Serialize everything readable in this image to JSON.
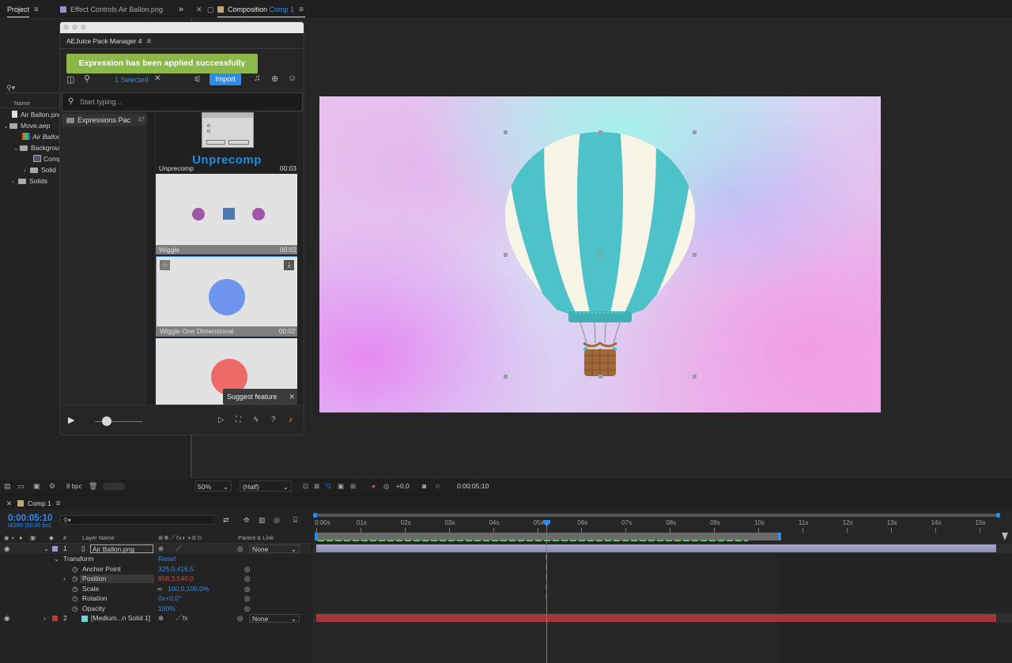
{
  "top_tabs": {
    "project": "Project",
    "effect_controls": "Effect Controls Air Ballon.png",
    "composition_prefix": "Composition",
    "composition_name": "Comp 1"
  },
  "project_panel": {
    "search_placeholder": "",
    "column_name": "Name",
    "items": [
      {
        "label": "Air Ballon.png"
      },
      {
        "label": "Move.aep"
      },
      {
        "label": "Air Ballon"
      },
      {
        "label": "Backgrou"
      },
      {
        "label": "Comp"
      },
      {
        "label": "Solid"
      },
      {
        "label": "Solids"
      }
    ],
    "footer_bpc": "8 bpc"
  },
  "pack_manager": {
    "title": "AEJuice Pack Manager 4",
    "toast": "Expression has been applied successfully",
    "selected_label": "1 Selected",
    "import_label": "Import",
    "search_placeholder": "Start typing...",
    "category_label": "Expressions Pac",
    "category_count": "47",
    "cards": [
      {
        "title": "Unprecomp",
        "label": "Unprecomp",
        "time": "00:03"
      },
      {
        "label": "Wiggle",
        "time": "00:02"
      },
      {
        "label": "Wiggle One Dimensional",
        "time": "00:02"
      },
      {
        "label": "",
        "time": ""
      }
    ],
    "suggest_feature": "Suggest feature"
  },
  "comp_footer": {
    "zoom": "50%",
    "resolution": "(Half)",
    "exposure": "+0,0",
    "timecode": "0:00:05:10"
  },
  "timeline": {
    "tab_label": "Comp 1",
    "current_time": "0:00:05:10",
    "frames_fps": "00260 (50.00 fps)",
    "col_layer_name": "Layer Name",
    "col_parent": "Parent & Link",
    "ticks": [
      "0:00s",
      "01s",
      "02s",
      "03s",
      "04s",
      "05s",
      "06s",
      "07s",
      "08s",
      "09s",
      "10s",
      "11s",
      "12s",
      "13s",
      "14s",
      "15s"
    ],
    "layers": [
      {
        "index": "1",
        "name": "Air Ballon.png",
        "parent": "None",
        "color": "#9a9ad6"
      },
      {
        "index": "2",
        "name": "[Medium...n Solid 1]",
        "parent": "None",
        "color": "#c0383a"
      }
    ],
    "transform": {
      "label": "Transform",
      "reset": "Reset",
      "props": [
        {
          "name": "Anchor Point",
          "value": "325,0,416,5"
        },
        {
          "name": "Position",
          "value": "958,3,540,0"
        },
        {
          "name": "Scale",
          "value": "100,0,100,0%"
        },
        {
          "name": "Rotation",
          "value": "0x+0,0°"
        },
        {
          "name": "Opacity",
          "value": "100%"
        }
      ]
    }
  }
}
